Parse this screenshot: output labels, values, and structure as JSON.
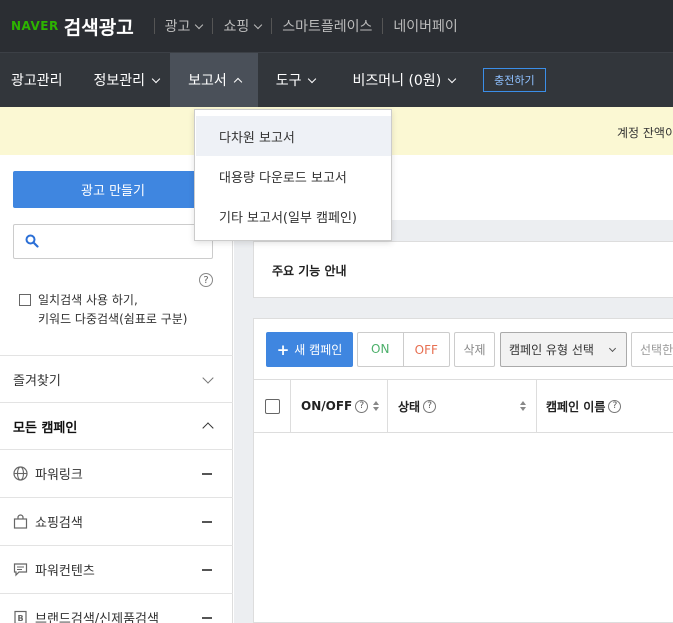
{
  "topbar": {
    "brand": "NAVER",
    "title": "검색광고",
    "links": [
      "광고",
      "쇼핑",
      "스마트플레이스",
      "네이버페이"
    ]
  },
  "nav": {
    "items": [
      "광고관리",
      "정보관리",
      "보고서",
      "도구",
      "비즈머니 (0원)"
    ],
    "charge_label": "충전하기"
  },
  "notice": {
    "text": "계정 잔액이"
  },
  "report_menu": {
    "items": [
      "다차원 보고서",
      "대용량 다운로드 보고서",
      "기타 보고서(일부 캠페인)"
    ]
  },
  "sidebar": {
    "create_ad_label": "광고 만들기",
    "search_placeholder": "",
    "help_mark": "?",
    "exact_match_line1": "일치검색 사용 하기,",
    "exact_match_line2": "키워드 다중검색(쉼표로 구분)",
    "favorites_label": "즐겨찾기",
    "all_campaigns_label": "모든 캠페인",
    "campaign_types": [
      "파워링크",
      "쇼핑검색",
      "파워컨텐츠",
      "브랜드검색/신제품검색"
    ]
  },
  "main": {
    "guide_title": "주요 기능 안내",
    "toolbar": {
      "new_campaign": "새 캠페인",
      "on": "ON",
      "off": "OFF",
      "delete": "삭제",
      "type_select": "캠페인 유형 선택",
      "select_more": "선택한"
    },
    "table": {
      "headers": [
        "ON/OFF",
        "상태",
        "캠페인 이름"
      ]
    }
  },
  "colors": {
    "topbar_bg": "#2b2e33",
    "nav_bg": "#32363b",
    "accent_blue": "#3f86e0",
    "brand_green": "#2db400",
    "notice_bg": "#fbf8d3"
  }
}
